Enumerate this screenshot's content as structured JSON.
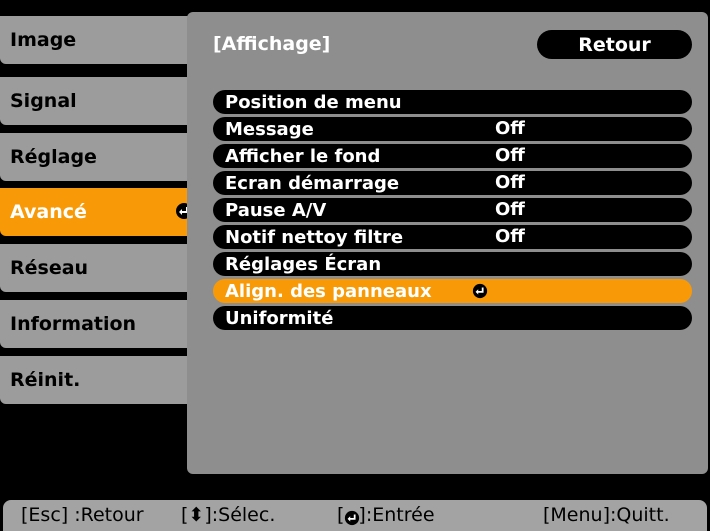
{
  "sidebar": {
    "items": [
      {
        "label": "Image"
      },
      {
        "label": "Signal"
      },
      {
        "label": "Réglage"
      },
      {
        "label": "Avancé"
      },
      {
        "label": "Réseau"
      },
      {
        "label": "Information"
      },
      {
        "label": "Réinit."
      }
    ],
    "active_index": 3
  },
  "panel": {
    "title": "[Affichage]",
    "back_label": "Retour",
    "rows": [
      {
        "label": "Position de menu",
        "value": ""
      },
      {
        "label": "Message",
        "value": "Off"
      },
      {
        "label": "Afficher le fond",
        "value": "Off"
      },
      {
        "label": "Ecran démarrage",
        "value": "Off"
      },
      {
        "label": "Pause A/V",
        "value": "Off"
      },
      {
        "label": "Notif nettoy filtre",
        "value": "Off"
      },
      {
        "label": "Réglages Écran",
        "value": ""
      },
      {
        "label": "Align. des panneaux",
        "value": ""
      },
      {
        "label": "Uniformité",
        "value": ""
      }
    ],
    "selected_index": 7
  },
  "help_bar": {
    "esc": "[Esc] :Retour",
    "select_prefix": "[",
    "select_suffix": "]:Sélec.",
    "enter_prefix": "[",
    "enter_suffix": "]:Entrée",
    "menu": "[Menu]:Quitt."
  },
  "colors": {
    "accent": "#f89a08",
    "tab": "#9c9c9c",
    "panel": "#8e8e8e",
    "background": "#000000"
  }
}
